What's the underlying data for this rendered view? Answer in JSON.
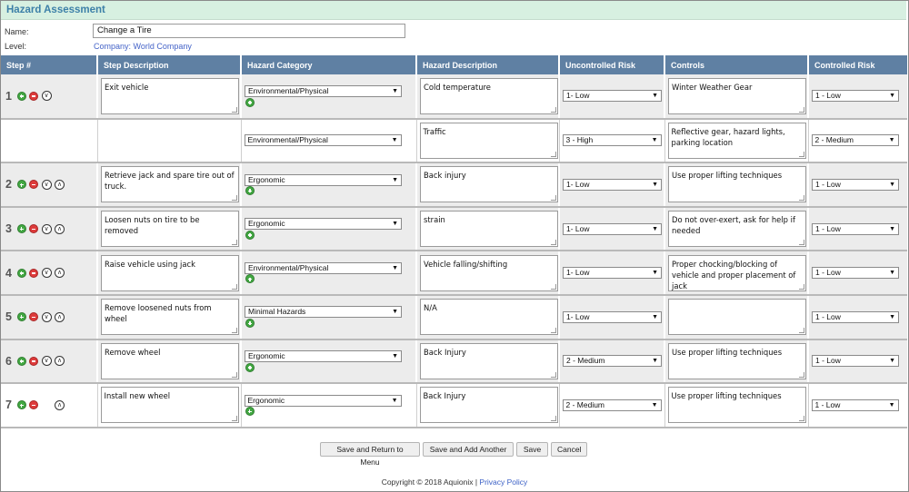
{
  "header": {
    "title": "Hazard Assessment"
  },
  "form": {
    "name_label": "Name:",
    "name_value": "Change a Tire",
    "level_label": "Level:",
    "level_value": "Company: World Company"
  },
  "columns": [
    "Step #",
    "Step Description",
    "Hazard Category",
    "Hazard Description",
    "Uncontrolled Risk",
    "Controls",
    "Controlled Risk"
  ],
  "rows": [
    {
      "step": "1",
      "step_desc": "Exit vehicle",
      "category": "Environmental/Physical",
      "hazard": "Cold temperature",
      "uncontrolled": "1- Low",
      "controls": "Winter Weather Gear",
      "controlled": "1 - Low"
    },
    {
      "step": "",
      "step_desc": "",
      "category": "Environmental/Physical",
      "hazard": "Traffic",
      "uncontrolled": "3 - High",
      "controls": "Reflective gear, hazard lights, parking location",
      "controlled": "2 - Medium"
    },
    {
      "step": "2",
      "step_desc": "Retrieve jack and spare tire out of truck.",
      "category": "Ergonomic",
      "hazard": "Back injury",
      "uncontrolled": "1- Low",
      "controls": "Use proper lifting techniques",
      "controlled": "1 - Low"
    },
    {
      "step": "3",
      "step_desc": "Loosen nuts on tire to be removed",
      "category": "Ergonomic",
      "hazard": "strain",
      "uncontrolled": "1- Low",
      "controls": "Do not over-exert, ask for help if needed",
      "controlled": "1 - Low"
    },
    {
      "step": "4",
      "step_desc": "Raise vehicle using jack",
      "category": "Environmental/Physical",
      "hazard": "Vehicle falling/shifting",
      "uncontrolled": "1- Low",
      "controls": "Proper chocking/blocking of vehicle and proper placement of jack",
      "controlled": "1 - Low"
    },
    {
      "step": "5",
      "step_desc": "Remove loosened nuts from wheel",
      "category": "Minimal Hazards",
      "hazard": "N/A",
      "uncontrolled": "1- Low",
      "controls": "",
      "controlled": "1 - Low"
    },
    {
      "step": "6",
      "step_desc": "Remove wheel",
      "category": "Ergonomic",
      "hazard": "Back Injury",
      "uncontrolled": "2 - Medium",
      "controls": "Use proper lifting techniques",
      "controlled": "1 - Low"
    },
    {
      "step": "7",
      "step_desc": "Install new wheel",
      "category": "Ergonomic",
      "hazard": "Back Injury",
      "uncontrolled": "2 - Medium",
      "controls": "Use proper lifting techniques",
      "controlled": "1 - Low"
    }
  ],
  "buttons": {
    "save_return": "Save and Return to Menu",
    "save_add": "Save and Add Another",
    "save": "Save",
    "cancel": "Cancel"
  },
  "footer": {
    "copyright": "Copyright © 2018 Aquionix |",
    "privacy": "Privacy Policy"
  },
  "colors": {
    "header_bg": "#d7f0e1",
    "title": "#3d80a8",
    "table_header": "#5f80a3",
    "link": "#4463c8",
    "add_icon": "#43a843",
    "remove_icon": "#dd3b3b"
  }
}
